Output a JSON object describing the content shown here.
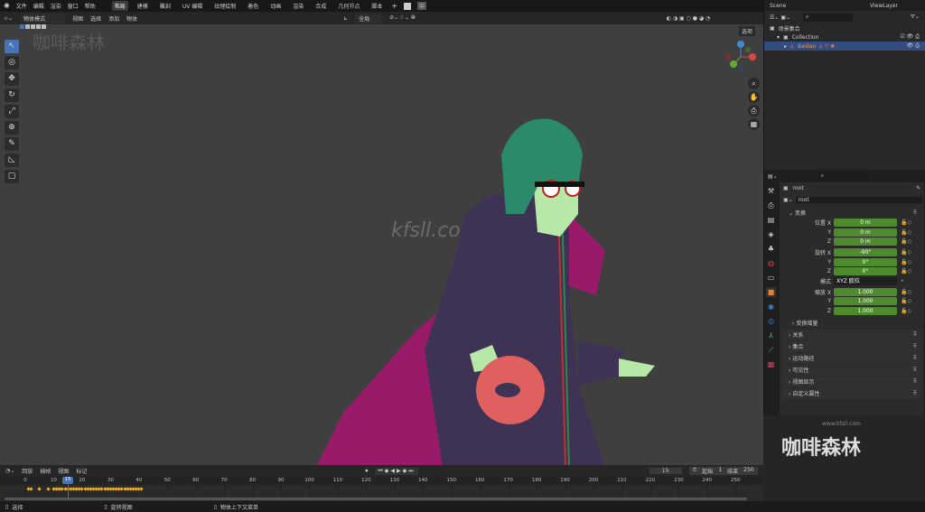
{
  "menu": {
    "items": [
      "文件",
      "编辑",
      "渲染",
      "窗口",
      "帮助"
    ],
    "workspaces": [
      "布局",
      "建模",
      "雕刻",
      "UV 编辑",
      "纹理绘制",
      "着色",
      "动画",
      "渲染",
      "合成",
      "几何节点",
      "脚本"
    ],
    "active_workspace": "布局"
  },
  "header": {
    "mode": "物体模式",
    "menus": [
      "视图",
      "选择",
      "添加",
      "物体"
    ],
    "orientation": "全局"
  },
  "viewport": {
    "options": "选项",
    "watermark_center": "kfsll.com",
    "watermark_corner": "咖啡森林",
    "gizmo_axes": [
      "X",
      "Y",
      "Z"
    ]
  },
  "scene": {
    "name": "Scene",
    "view_layer": "ViewLayer"
  },
  "outliner": {
    "scene_collection": "场景集合",
    "collection": "Collection",
    "object": "daidao"
  },
  "properties": {
    "object_name": "root",
    "data_name": "root",
    "transform_label": "变换",
    "location": {
      "label": "位置",
      "x": "0 m",
      "y": "0 m",
      "z": "0 m"
    },
    "rotation": {
      "label": "旋转",
      "x": "-90°",
      "y": "0°",
      "z": "0°"
    },
    "mode_label": "模式",
    "mode_value": "XYZ 欧拉",
    "scale": {
      "label": "缩放",
      "x": "1.000",
      "y": "1.000",
      "z": "1.000"
    },
    "delta": "变换增量",
    "sections": [
      "关系",
      "集合",
      "运动路径",
      "可见性",
      "视图显示",
      "自定义属性"
    ]
  },
  "timeline": {
    "menus": [
      "回放",
      "插帧",
      "视图",
      "标记"
    ],
    "current_frame": "15",
    "start_label": "起始",
    "start": "1",
    "end_label": "结束",
    "end": "250",
    "ticks": [
      "0",
      "10",
      "20",
      "30",
      "40",
      "50",
      "60",
      "70",
      "80",
      "90",
      "100",
      "110",
      "120",
      "130",
      "140",
      "150",
      "160",
      "170",
      "180",
      "190",
      "200",
      "210",
      "220",
      "230",
      "240",
      "250"
    ]
  },
  "status": {
    "items": [
      "选择",
      "旋转视图",
      "物体上下文菜单"
    ]
  },
  "brand": {
    "url": "www.kfsll.com",
    "name": "咖啡森林"
  },
  "colors": {
    "accent": "#4772b3",
    "field_green": "#4e8a2e",
    "keyframe": "#f0b020"
  }
}
